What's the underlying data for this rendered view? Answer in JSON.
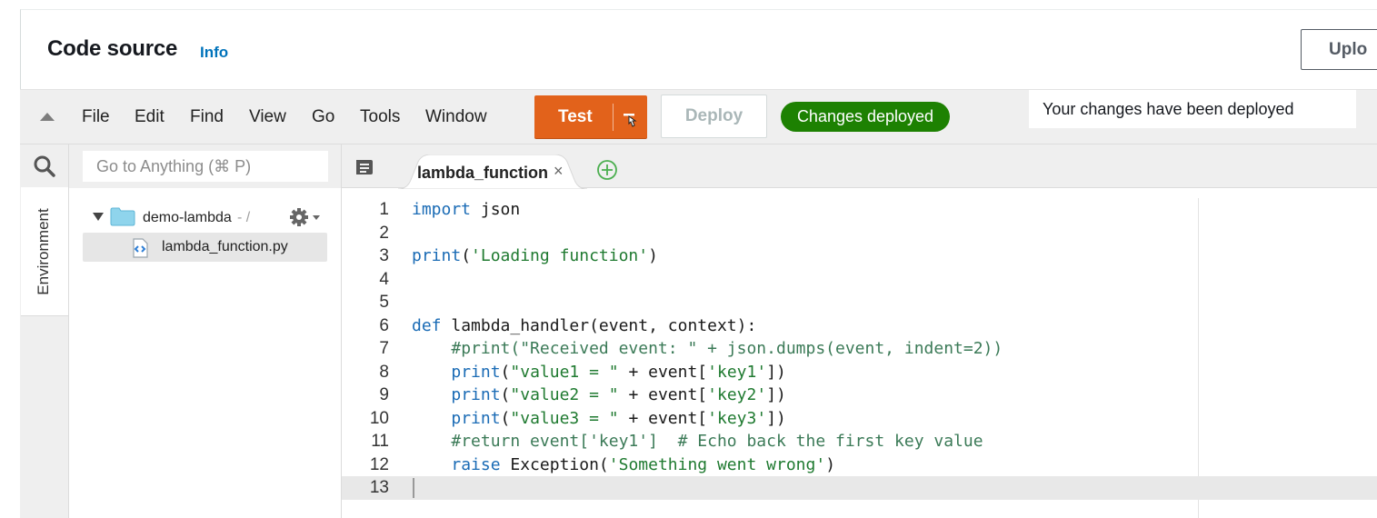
{
  "header": {
    "title": "Code source",
    "info_link": "Info",
    "upload_button": "Uplo"
  },
  "menubar": {
    "items": [
      "File",
      "Edit",
      "Find",
      "View",
      "Go",
      "Tools",
      "Window"
    ],
    "test_button": "Test",
    "deploy_button": "Deploy",
    "status_badge": "Changes deployed",
    "toast_message": "Your changes have been deployed"
  },
  "sidebar": {
    "goto_placeholder": "Go to Anything (⌘ P)",
    "environment_tab": "Environment",
    "tree": {
      "folder_name": "demo-lambda",
      "folder_path": "- /",
      "file_name": "lambda_function.py"
    }
  },
  "editor": {
    "active_tab": "lambda_function",
    "lines": [
      {
        "n": "1",
        "html": "<span class=\"kw\">import</span> json"
      },
      {
        "n": "2",
        "html": ""
      },
      {
        "n": "3",
        "html": "<span class=\"kw\">print</span>(<span class=\"str\">'Loading function'</span>)"
      },
      {
        "n": "4",
        "html": ""
      },
      {
        "n": "5",
        "html": ""
      },
      {
        "n": "6",
        "html": "<span class=\"kw\">def</span> lambda_handler(event, context):"
      },
      {
        "n": "7",
        "html": "    <span class=\"cm\">#print(\"Received event: \" + json.dumps(event, indent=2))</span>"
      },
      {
        "n": "8",
        "html": "    <span class=\"kw\">print</span>(<span class=\"str\">\"value1 = \"</span> + event[<span class=\"str\">'key1'</span>])"
      },
      {
        "n": "9",
        "html": "    <span class=\"kw\">print</span>(<span class=\"str\">\"value2 = \"</span> + event[<span class=\"str\">'key2'</span>])"
      },
      {
        "n": "10",
        "html": "    <span class=\"kw\">print</span>(<span class=\"str\">\"value3 = \"</span> + event[<span class=\"str\">'key3'</span>])"
      },
      {
        "n": "11",
        "html": "    <span class=\"cm\">#return event['key1']  # Echo back the first key value</span>"
      },
      {
        "n": "12",
        "html": "    <span class=\"kw\">raise</span> Exception(<span class=\"str\">'Something went wrong'</span>)"
      },
      {
        "n": "13",
        "html": ""
      }
    ]
  },
  "colors": {
    "test_button": "#e2621b",
    "status_badge": "#1d8102",
    "info_link": "#0073bb",
    "keyword": "#1a6bb5",
    "string": "#1f7a30"
  },
  "icons": [
    "collapse-arrow-icon",
    "caret-down-icon",
    "search-icon",
    "folder-icon",
    "gear-icon",
    "python-file-icon",
    "tab-list-icon",
    "close-icon",
    "add-tab-icon"
  ]
}
